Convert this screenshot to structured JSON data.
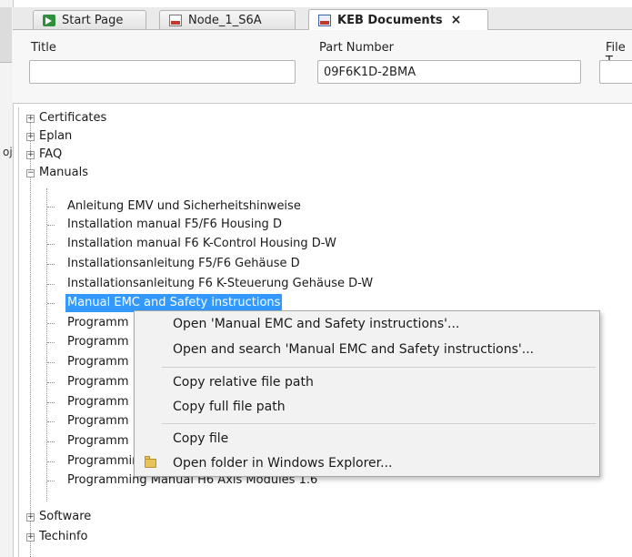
{
  "left_panel": {
    "glyph": "oj"
  },
  "tabs": [
    {
      "label": "Start Page",
      "icon": "start-page-icon"
    },
    {
      "label": "Node_1_S6A",
      "icon": "node-icon"
    },
    {
      "label": "KEB Documents",
      "icon": "keb-documents-icon",
      "close": "×"
    }
  ],
  "properties": {
    "title": {
      "label": "Title",
      "value": ""
    },
    "part_number": {
      "label": "Part Number",
      "value": "09F6K1D-2BMA"
    },
    "file_type": {
      "label": "File T"
    }
  },
  "tree": {
    "expander_collapsed": "+",
    "expander_expanded": "−",
    "root_items": [
      {
        "label": "Certificates",
        "expanded": false
      },
      {
        "label": "Eplan",
        "expanded": false
      },
      {
        "label": "FAQ",
        "expanded": false
      },
      {
        "label": "Manuals",
        "expanded": true
      }
    ],
    "manual_children": [
      "Anleitung EMV und Sicherheitshinweise",
      "Installation manual F5/F6 Housing D",
      "Installation manual F6 K-Control Housing D-W",
      "Installationsanleitung F5/F6 Gehäuse D",
      "Installationsanleitung F6 K-Steuerung Gehäuse D-W",
      "Manual EMC and Safety instructions",
      "Programm",
      "Programm",
      "Programm",
      "Programm",
      "Programm",
      "Programm",
      "Programm",
      "Programming Manual H6 Axis Modules 1.4",
      "Programming Manual H6 Axis Modules 1.6"
    ],
    "selected_child": "Manual EMC and Safety instructions",
    "trailing_items": [
      {
        "label": "Software",
        "expanded": false
      },
      {
        "label": "Techinfo",
        "expanded": false
      }
    ]
  },
  "context_menu": {
    "items": [
      {
        "label": "Open 'Manual EMC and Safety instructions'..."
      },
      {
        "label": "Open and search 'Manual EMC and Safety instructions'..."
      },
      {
        "label": "Copy relative file path"
      },
      {
        "label": "Copy full file path"
      },
      {
        "label": "Copy file"
      },
      {
        "label": "Open folder in Windows Explorer...",
        "icon": "folder-icon"
      }
    ]
  },
  "colors": {
    "selection": "#3399ff",
    "menu_background": "#f2f2f2"
  }
}
